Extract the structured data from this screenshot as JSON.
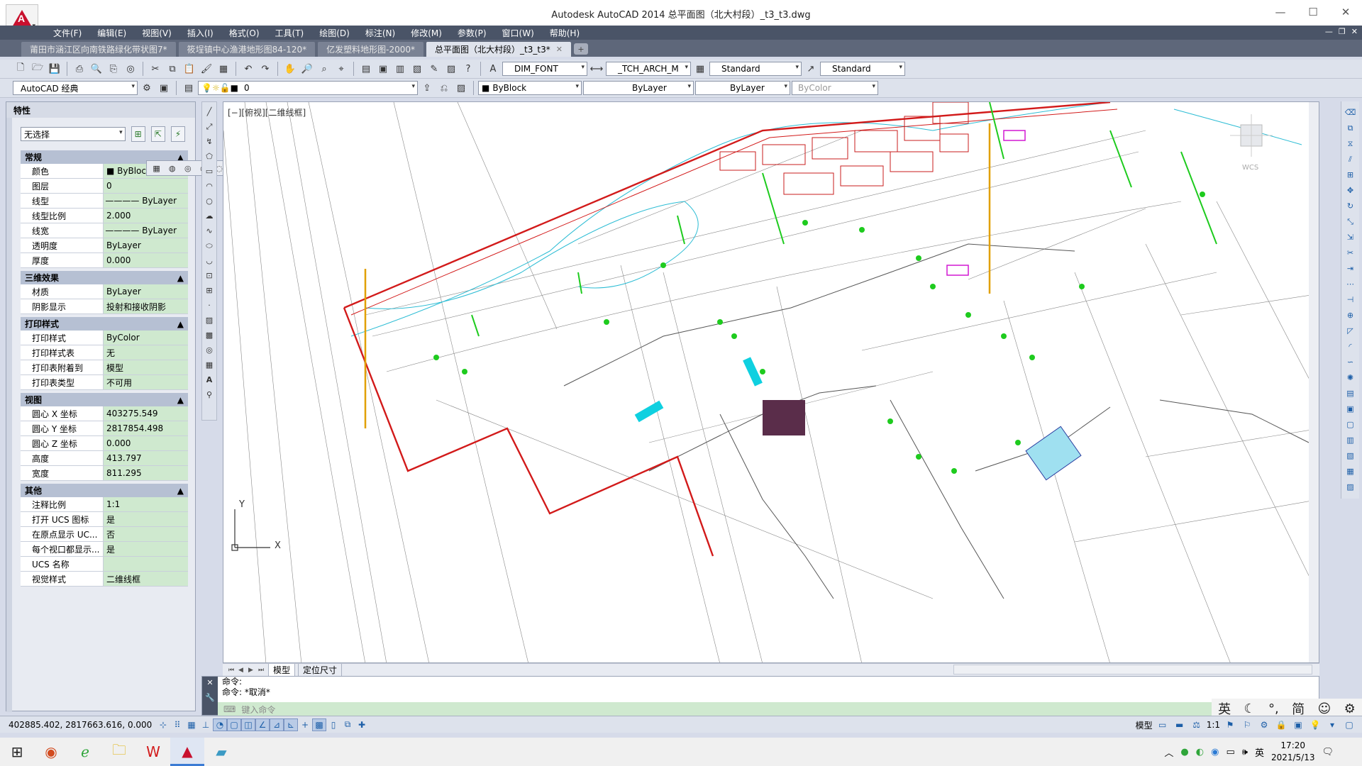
{
  "window": {
    "title": "Autodesk AutoCAD 2014    总平面图（北大村段）_t3_t3.dwg",
    "menus": [
      "文件(F)",
      "编辑(E)",
      "视图(V)",
      "插入(I)",
      "格式(O)",
      "工具(T)",
      "绘图(D)",
      "标注(N)",
      "修改(M)",
      "参数(P)",
      "窗口(W)",
      "帮助(H)"
    ]
  },
  "tabs": [
    {
      "label": "莆田市涵江区向南铁路绿化带状图7*"
    },
    {
      "label": "筱埕镇中心渔港地形图84-120*"
    },
    {
      "label": "亿发塑料地形图-2000*"
    },
    {
      "label": "总平面图（北大村段）_t3_t3*"
    }
  ],
  "toolbar1": {
    "text_style": "DIM_FONT",
    "dim_style": "_TCH_ARCH_M",
    "table_style": "Standard",
    "mleader_style": "Standard"
  },
  "toolbar2": {
    "workspace": "AutoCAD 经典",
    "layer": "0",
    "color": "ByBlock",
    "linetype": "ByLayer",
    "lineweight": "ByLayer",
    "plotstyle": "ByColor"
  },
  "palette": {
    "title": "特性",
    "selection": "无选择",
    "sections": [
      {
        "title": "常规",
        "rows": [
          {
            "k": "颜色",
            "v": "■ ByBlock"
          },
          {
            "k": "图层",
            "v": "0"
          },
          {
            "k": "线型",
            "v": "———— ByLayer"
          },
          {
            "k": "线型比例",
            "v": "2.000"
          },
          {
            "k": "线宽",
            "v": "———— ByLayer"
          },
          {
            "k": "透明度",
            "v": "ByLayer"
          },
          {
            "k": "厚度",
            "v": "0.000"
          }
        ]
      },
      {
        "title": "三维效果",
        "rows": [
          {
            "k": "材质",
            "v": "ByLayer"
          },
          {
            "k": "阴影显示",
            "v": "投射和接收阴影"
          }
        ]
      },
      {
        "title": "打印样式",
        "rows": [
          {
            "k": "打印样式",
            "v": "ByColor"
          },
          {
            "k": "打印样式表",
            "v": "无"
          },
          {
            "k": "打印表附着到",
            "v": "模型"
          },
          {
            "k": "打印表类型",
            "v": "不可用"
          }
        ]
      },
      {
        "title": "视图",
        "rows": [
          {
            "k": "圆心 X 坐标",
            "v": "403275.549"
          },
          {
            "k": "圆心 Y 坐标",
            "v": "2817854.498"
          },
          {
            "k": "圆心 Z 坐标",
            "v": "0.000"
          },
          {
            "k": "高度",
            "v": "413.797"
          },
          {
            "k": "宽度",
            "v": "811.295"
          }
        ]
      },
      {
        "title": "其他",
        "rows": [
          {
            "k": "注释比例",
            "v": "1:1"
          },
          {
            "k": "打开 UCS 图标",
            "v": "是"
          },
          {
            "k": "在原点显示 UC...",
            "v": "否"
          },
          {
            "k": "每个视口都显示...",
            "v": "是"
          },
          {
            "k": "UCS 名称",
            "v": ""
          },
          {
            "k": "视觉样式",
            "v": "二维线框"
          }
        ]
      }
    ]
  },
  "viewport": {
    "label": "[−][俯视][二维线框]",
    "ucs_x": "X",
    "ucs_y": "Y",
    "wcs": "WCS"
  },
  "layouts": [
    "模型",
    "定位尺寸"
  ],
  "command": {
    "line1": "命令:",
    "line2": "命令: *取消*",
    "placeholder": "键入命令"
  },
  "status": {
    "coords": "402885.402, 2817663.616, 0.000",
    "model": "模型",
    "scale": "1:1"
  },
  "ime": {
    "lang": "英",
    "mode": "简"
  },
  "clock": {
    "time": "17:20",
    "date": "2021/5/13",
    "tray_lang": "英"
  }
}
